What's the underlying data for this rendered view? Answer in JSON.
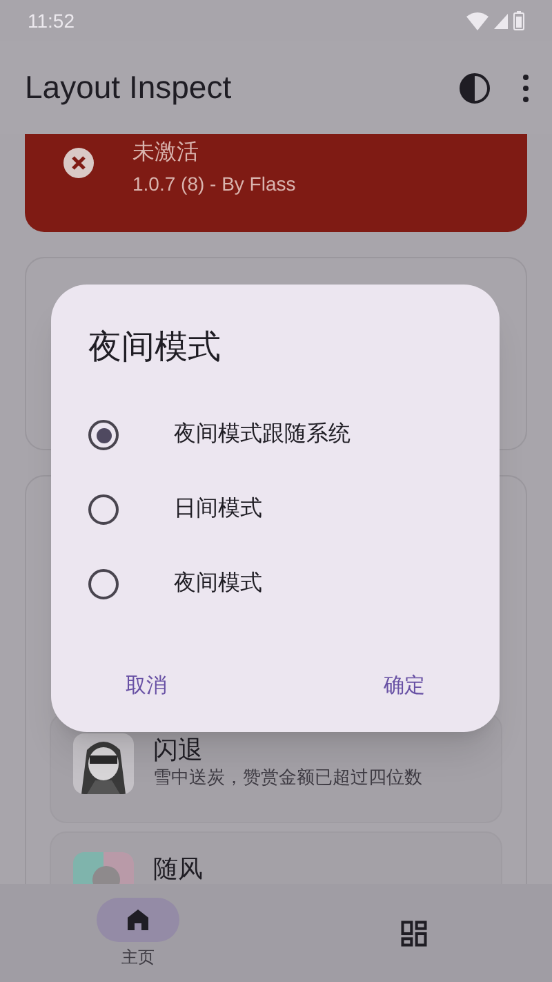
{
  "status_bar": {
    "time": "11:52"
  },
  "app_bar": {
    "title": "Layout Inspect"
  },
  "status_card": {
    "title": "未激活",
    "subtitle": "1.0.7 (8) - By Flass"
  },
  "donors": [
    {
      "name": "闪退",
      "note": "雪中送炭，赞赏金额已超过四位数"
    },
    {
      "name": "随风"
    }
  ],
  "dialog": {
    "title": "夜间模式",
    "options": [
      {
        "label": "夜间模式跟随系统",
        "selected": true
      },
      {
        "label": "日间模式",
        "selected": false
      },
      {
        "label": "夜间模式",
        "selected": false
      }
    ],
    "buttons": [
      "取消",
      "确定"
    ]
  },
  "bottom_nav": [
    {
      "label": "主页",
      "selected": true,
      "kind": "home"
    },
    {
      "selected": false,
      "kind": "grid"
    }
  ]
}
